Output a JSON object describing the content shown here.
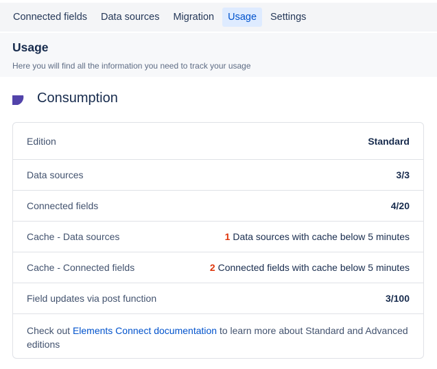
{
  "tabs": [
    {
      "label": "Connected fields"
    },
    {
      "label": "Data sources"
    },
    {
      "label": "Migration"
    },
    {
      "label": "Usage"
    },
    {
      "label": "Settings"
    }
  ],
  "header": {
    "title": "Usage",
    "subtitle": "Here you will find all the information you need to track your usage"
  },
  "section": {
    "title": "Consumption",
    "icon": "pie-quarter-icon",
    "icon_color": "#5243aa"
  },
  "consumption": {
    "edition": {
      "label": "Edition",
      "value": "Standard"
    },
    "data_sources": {
      "label": "Data sources",
      "value": "3/3"
    },
    "connected_fields": {
      "label": "Connected fields",
      "value": "4/20"
    },
    "cache_data_sources": {
      "label": "Cache - Data sources",
      "count": "1",
      "text": "Data sources with cache below 5 minutes"
    },
    "cache_connected_fields": {
      "label": "Cache - Connected fields",
      "count": "2",
      "text": "Connected fields with cache below 5 minutes"
    },
    "field_updates": {
      "label": "Field updates via post function",
      "value": "3/100"
    }
  },
  "footer": {
    "prefix": "Check out ",
    "link": "Elements Connect documentation",
    "suffix": " to learn more about Standard and Advanced editions"
  },
  "colors": {
    "accent": "#0052cc",
    "warning_number": "#de350b",
    "active_tab_bg": "#deebff"
  }
}
